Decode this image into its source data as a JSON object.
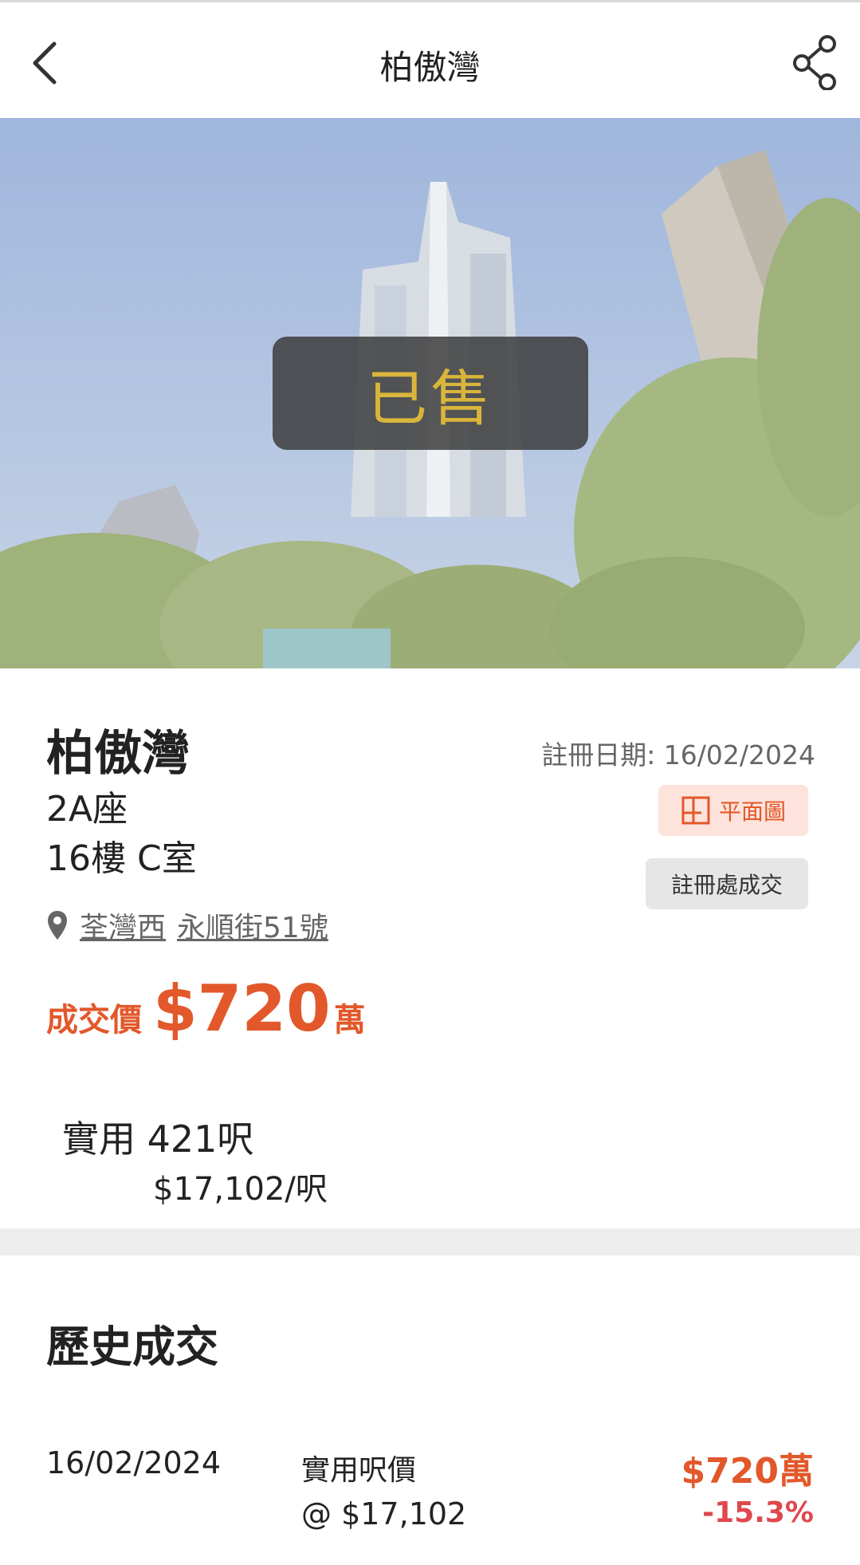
{
  "header": {
    "title": "柏傲灣"
  },
  "hero": {
    "status_overlay": "已售"
  },
  "listing": {
    "estate_name": "柏傲灣",
    "block": "2A座",
    "unit": "16樓 C室",
    "registration_date": "註冊日期: 16/02/2024",
    "floorplan_label": "平面圖",
    "registry_label": "註冊處成交",
    "district": "荃灣西",
    "address": "永順街51號",
    "price_label": "成交價",
    "price_value": "$720",
    "price_unit": "萬",
    "saleable_area": "實用 421呎",
    "price_per_sqft": "$17,102/呎"
  },
  "history": {
    "title": "歷史成交",
    "records": [
      {
        "date": "16/02/2024",
        "ppsf_label": "實用呎價",
        "ppsf_value": "@ $17,102",
        "price": "$720萬",
        "change": "-15.3%"
      }
    ]
  },
  "colors": {
    "accent": "#e2582a",
    "negative": "#e0474c",
    "sold_text": "#d9b53b"
  },
  "icons": [
    "back-arrow-icon",
    "share-icon",
    "floorplan-icon",
    "location-pin-icon"
  ]
}
